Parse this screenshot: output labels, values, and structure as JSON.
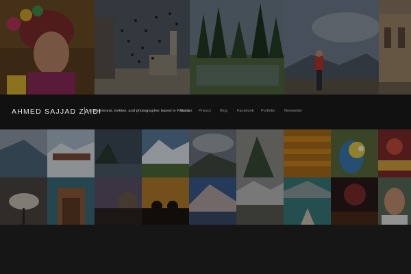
{
  "header": {
    "site_title": "AHMED SAJJAD ZAIDI",
    "tagline": "Entrepreneur, trekker, and photographer based in Pakistan",
    "nav": [
      "About",
      "Privacy",
      "Blog",
      "Facebook",
      "Portfolio",
      "Newsletter"
    ]
  },
  "gallery": {
    "top_row": [
      "portrait-woman",
      "birds-mosque",
      "forest-lake",
      "hiker-photographer",
      "fort-ruins"
    ],
    "row_two": [
      "hillside-snow",
      "trekkers-snow",
      "mountain-lake",
      "snow-peak-valley",
      "cloudy-valley",
      "rocky-hill",
      "wood-planks",
      "parrot",
      "embroidery"
    ],
    "row_three": [
      "dove",
      "tiled-door",
      "mosque-dusk",
      "domes-silhouette",
      "mountain-lake-two",
      "river-canyon",
      "boat-lake",
      "fireworks",
      "man-portrait"
    ]
  }
}
